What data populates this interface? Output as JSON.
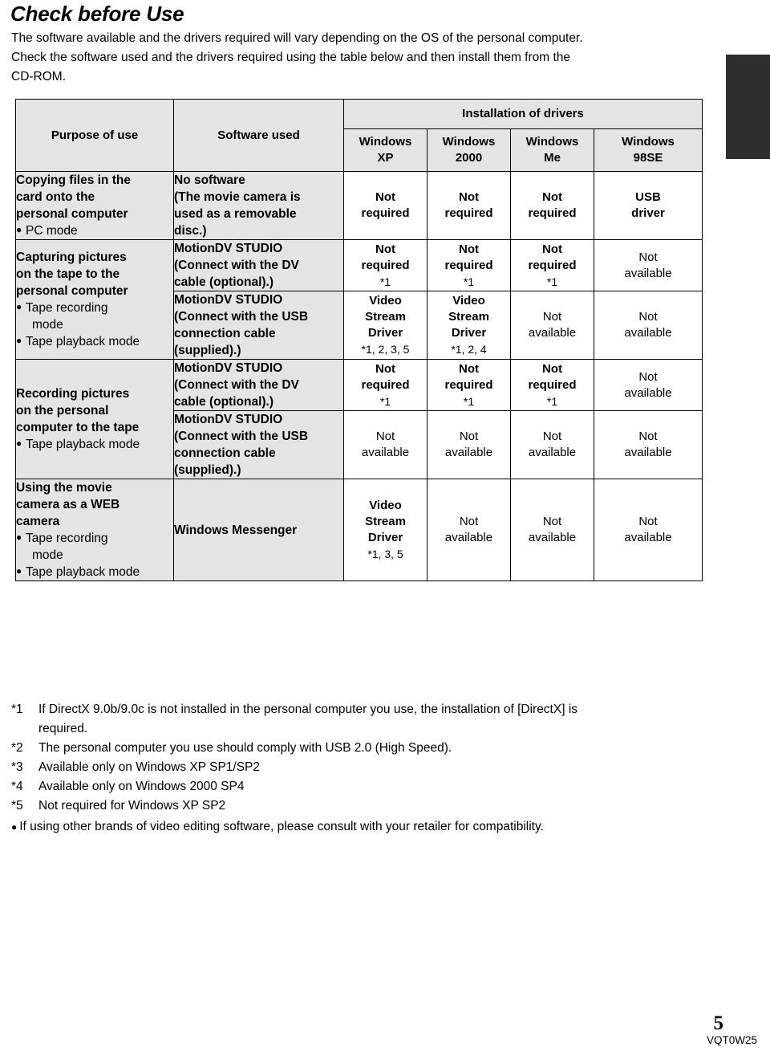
{
  "heading": {
    "title": "Check before Use",
    "paragraph_lines": [
      "The software available and the drivers required will vary depending on the OS of the personal computer.",
      "Check the software used and the drivers required using the table below and then install them from the",
      "CD-ROM."
    ]
  },
  "table": {
    "headers": {
      "purpose": "Purpose of use",
      "software": "Software used",
      "drivers_group": "Installation of drivers",
      "os": [
        {
          "line1": "Windows",
          "line2": "XP"
        },
        {
          "line1": "Windows",
          "line2": "2000"
        },
        {
          "line1": "Windows",
          "line2": "Me"
        },
        {
          "line1": "Windows",
          "line2": "98SE"
        }
      ]
    },
    "rows": [
      {
        "purpose_title_lines": [
          "Copying files in the",
          "card onto the",
          "personal computer"
        ],
        "purpose_bullets": [
          {
            "bullet": "●",
            "text": "PC mode"
          }
        ],
        "subrows": [
          {
            "software_lines": [
              "No software",
              "(The movie camera is",
              "used as a removable",
              "disc.)"
            ],
            "cells": [
              {
                "bold": true,
                "line1": "Not",
                "line2": "required",
                "note": ""
              },
              {
                "bold": true,
                "line1": "Not",
                "line2": "required",
                "note": ""
              },
              {
                "bold": true,
                "line1": "Not",
                "line2": "required",
                "note": ""
              },
              {
                "bold": true,
                "line1": "USB",
                "line2": "driver",
                "note": ""
              }
            ]
          }
        ]
      },
      {
        "purpose_title_lines": [
          "Capturing pictures",
          "on the tape to the",
          "personal computer"
        ],
        "purpose_bullets": [
          {
            "bullet": "●",
            "text": "Tape recording"
          },
          {
            "bullet": "",
            "text": "mode"
          },
          {
            "bullet": "●",
            "text": "Tape playback mode"
          }
        ],
        "subrows": [
          {
            "software_lines": [
              "MotionDV STUDIO",
              "(Connect with the DV",
              "cable (optional).)"
            ],
            "cells": [
              {
                "bold": true,
                "line1": "Not",
                "line2": "required",
                "note": "*1"
              },
              {
                "bold": true,
                "line1": "Not",
                "line2": "required",
                "note": "*1"
              },
              {
                "bold": true,
                "line1": "Not",
                "line2": "required",
                "note": "*1"
              },
              {
                "bold": false,
                "line1": "Not",
                "line2": "available",
                "note": ""
              }
            ]
          },
          {
            "software_lines": [
              "MotionDV STUDIO",
              "(Connect with the USB",
              "connection cable",
              "(supplied).)"
            ],
            "cells": [
              {
                "bold": true,
                "line1": "Video",
                "line2": "Stream",
                "line3": "Driver",
                "note": "*1, 2, 3, 5"
              },
              {
                "bold": true,
                "line1": "Video",
                "line2": "Stream",
                "line3": "Driver",
                "note": "*1, 2, 4"
              },
              {
                "bold": false,
                "line1": "Not",
                "line2": "available",
                "note": ""
              },
              {
                "bold": false,
                "line1": "Not",
                "line2": "available",
                "note": ""
              }
            ]
          }
        ]
      },
      {
        "purpose_title_lines": [
          "Recording pictures",
          "on the personal",
          "computer to the tape"
        ],
        "purpose_bullets": [
          {
            "bullet": "●",
            "text": "Tape playback mode"
          }
        ],
        "subrows": [
          {
            "software_lines": [
              "MotionDV STUDIO",
              "(Connect with the DV",
              "cable (optional).)"
            ],
            "cells": [
              {
                "bold": true,
                "line1": "Not",
                "line2": "required",
                "note": "*1"
              },
              {
                "bold": true,
                "line1": "Not",
                "line2": "required",
                "note": "*1"
              },
              {
                "bold": true,
                "line1": "Not",
                "line2": "required",
                "note": "*1"
              },
              {
                "bold": false,
                "line1": "Not",
                "line2": "available",
                "note": ""
              }
            ]
          },
          {
            "software_lines": [
              "MotionDV STUDIO",
              "(Connect with the USB",
              "connection cable",
              "(supplied).)"
            ],
            "cells": [
              {
                "bold": false,
                "line1": "Not",
                "line2": "available",
                "note": ""
              },
              {
                "bold": false,
                "line1": "Not",
                "line2": "available",
                "note": ""
              },
              {
                "bold": false,
                "line1": "Not",
                "line2": "available",
                "note": ""
              },
              {
                "bold": false,
                "line1": "Not",
                "line2": "available",
                "note": ""
              }
            ]
          }
        ]
      },
      {
        "purpose_title_lines": [
          "Using the movie",
          "camera as a WEB",
          "camera"
        ],
        "purpose_bullets": [
          {
            "bullet": "●",
            "text": "Tape recording"
          },
          {
            "bullet": "",
            "text": "mode"
          },
          {
            "bullet": "●",
            "text": "Tape playback mode"
          }
        ],
        "subrows": [
          {
            "software_lines": [
              "Windows Messenger"
            ],
            "cells": [
              {
                "bold": true,
                "line1": "Video",
                "line2": "Stream",
                "line3": "Driver",
                "note": "*1, 3, 5"
              },
              {
                "bold": false,
                "line1": "Not",
                "line2": "available",
                "note": ""
              },
              {
                "bold": false,
                "line1": "Not",
                "line2": "available",
                "note": ""
              },
              {
                "bold": false,
                "line1": "Not",
                "line2": "available",
                "note": ""
              }
            ]
          }
        ]
      }
    ]
  },
  "footnotes": {
    "items": [
      {
        "mark": "*1",
        "text": "If DirectX 9.0b/9.0c is not installed in the personal computer you use, the installation of [DirectX] is",
        "text2": "required."
      },
      {
        "mark": "*2",
        "text": "The personal computer you use should comply with USB 2.0 (High Speed).",
        "text2": ""
      },
      {
        "mark": "*3",
        "text": "Available only on Windows XP SP1/SP2",
        "text2": ""
      },
      {
        "mark": "*4",
        "text": "Available only on Windows 2000 SP4",
        "text2": ""
      },
      {
        "mark": "*5",
        "text": "Not required for Windows XP SP2",
        "text2": ""
      }
    ],
    "closing_bullet": "●",
    "closing": "If using other brands of video editing software, please consult with your retailer for compatibility."
  },
  "footer": {
    "page_number": "5",
    "doc_code": "VQT0W25"
  },
  "colors": {
    "shaded_cell": "#e4e4e4",
    "tab_marker": "#2e2e2e",
    "border": "#000000"
  }
}
